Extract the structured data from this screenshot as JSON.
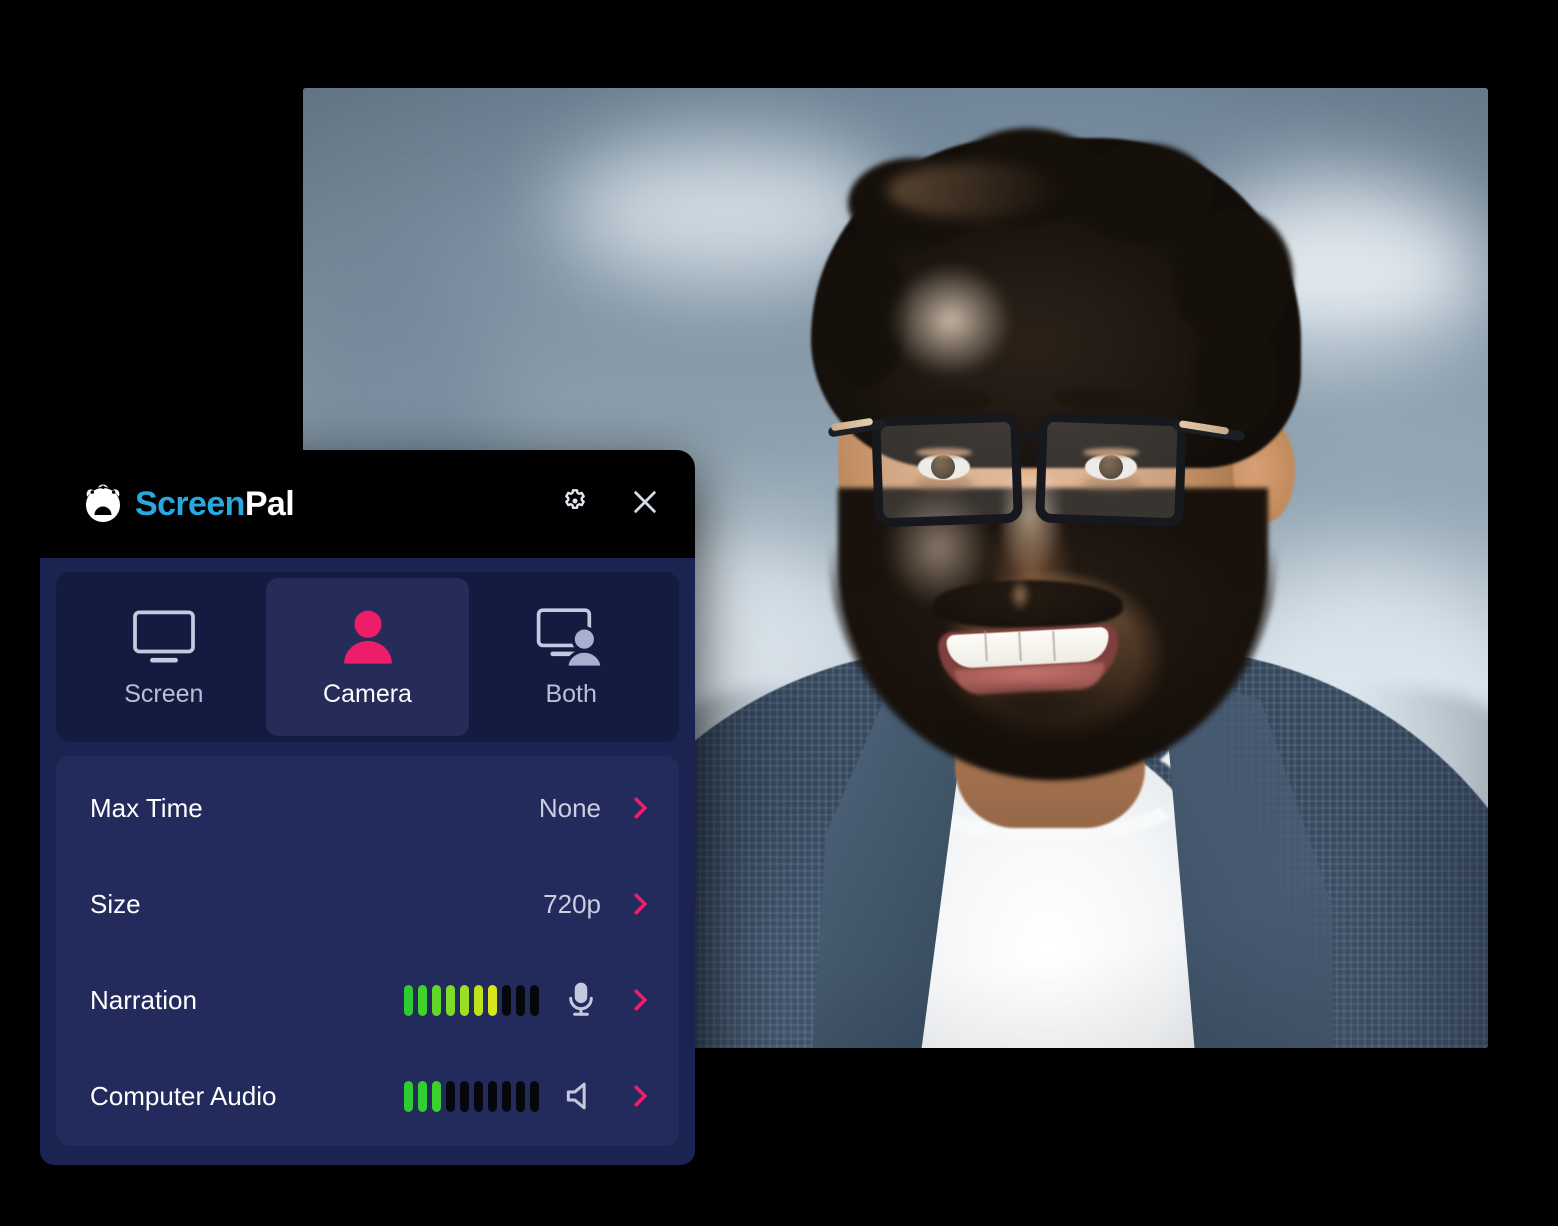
{
  "app": {
    "brand_first": "Screen",
    "brand_second": "Pal",
    "brand_color": "#29a8e0",
    "accent_color": "#ee1d6a",
    "panel_bg": "#1b2350",
    "header_bg": "#000000"
  },
  "header": {
    "settings_icon": "gear-icon",
    "close_icon": "close-icon"
  },
  "tabs": [
    {
      "id": "screen",
      "label": "Screen",
      "icon": "monitor-icon",
      "active": false
    },
    {
      "id": "camera",
      "label": "Camera",
      "icon": "person-icon",
      "active": true
    },
    {
      "id": "both",
      "label": "Both",
      "icon": "monitor-person-icon",
      "active": false
    }
  ],
  "settings": [
    {
      "id": "max-time",
      "label": "Max Time",
      "value": "None",
      "type": "value",
      "chevron": "chevron-right-icon"
    },
    {
      "id": "size",
      "label": "Size",
      "value": "720p",
      "type": "value",
      "chevron": "chevron-right-icon"
    },
    {
      "id": "narration",
      "label": "Narration",
      "type": "meter",
      "icon": "microphone-icon",
      "chevron": "chevron-right-icon",
      "meter": {
        "total": 10,
        "lit": 7,
        "colors": [
          "#2ecc33",
          "#3fd32b",
          "#61d728",
          "#7edb26",
          "#9bdf22",
          "#bde31e",
          "#d8e51a"
        ]
      }
    },
    {
      "id": "computer-audio",
      "label": "Computer Audio",
      "type": "meter",
      "icon": "speaker-icon",
      "chevron": "chevron-right-icon",
      "meter": {
        "total": 10,
        "lit": 3,
        "colors": [
          "#2ecc33",
          "#33ce31",
          "#3ad02e"
        ]
      }
    }
  ],
  "video": {
    "name": "camera-preview",
    "description": "Smiling bearded man with glasses in a blue tweed blazer and white t-shirt, blurred office background"
  }
}
